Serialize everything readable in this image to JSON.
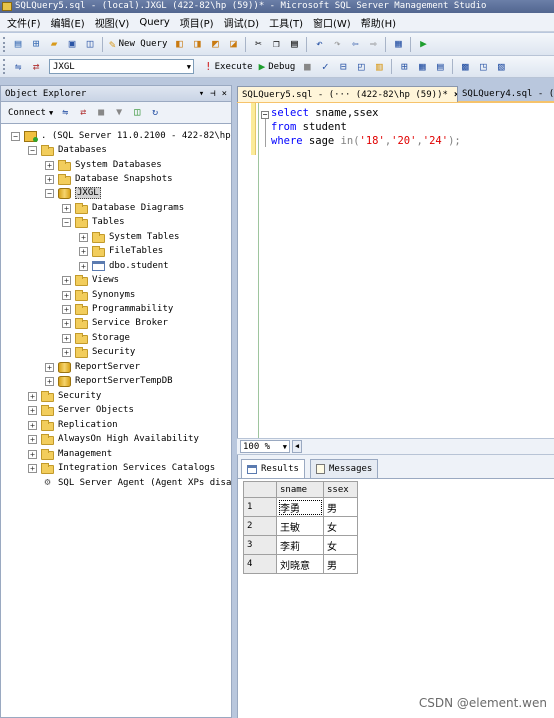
{
  "window": {
    "title": "SQLQuery5.sql - (local).JXGL (422-82\\hp (59))* - Microsoft SQL Server Management Studio"
  },
  "menu": [
    {
      "label": "文件(F)"
    },
    {
      "label": "编辑(E)"
    },
    {
      "label": "视图(V)"
    },
    {
      "label": "Query"
    },
    {
      "label": "项目(P)"
    },
    {
      "label": "调试(D)"
    },
    {
      "label": "工具(T)"
    },
    {
      "label": "窗口(W)"
    },
    {
      "label": "帮助(H)"
    }
  ],
  "toolbar1": {
    "new_query": "New Query"
  },
  "toolbar2": {
    "database": "JXGL",
    "execute": "Execute",
    "debug": "Debug"
  },
  "object_explorer": {
    "title": "Object Explorer",
    "connect": "Connect",
    "tree": [
      {
        "label": ". (SQL Server 11.0.2100 - 422-82\\hp)"
      },
      {
        "label": "Databases"
      },
      {
        "label": "System Databases"
      },
      {
        "label": "Database Snapshots"
      },
      {
        "label": "JXGL"
      },
      {
        "label": "Database Diagrams"
      },
      {
        "label": "Tables"
      },
      {
        "label": "System Tables"
      },
      {
        "label": "FileTables"
      },
      {
        "label": "dbo.student"
      },
      {
        "label": "Views"
      },
      {
        "label": "Synonyms"
      },
      {
        "label": "Programmability"
      },
      {
        "label": "Service Broker"
      },
      {
        "label": "Storage"
      },
      {
        "label": "Security"
      },
      {
        "label": "ReportServer"
      },
      {
        "label": "ReportServerTempDB"
      },
      {
        "label": "Security"
      },
      {
        "label": "Server Objects"
      },
      {
        "label": "Replication"
      },
      {
        "label": "AlwaysOn High Availability"
      },
      {
        "label": "Management"
      },
      {
        "label": "Integration Services Catalogs"
      },
      {
        "label": "SQL Server Agent (Agent XPs disabled)"
      }
    ]
  },
  "tabs": {
    "active": "SQLQuery5.sql - (··· (422-82\\hp (59))*",
    "inactive": "SQLQuery4.sql - (",
    "close": "×"
  },
  "editor": {
    "line1": {
      "kw": "select",
      "rest": " sname,ssex"
    },
    "line2": {
      "kw": "from",
      "rest": " student"
    },
    "line3": {
      "kw": "where",
      "col": " sage ",
      "op": "in",
      "p1": "(",
      "s1": "'18'",
      "c1": ",",
      "s2": "'20'",
      "c2": ",",
      "s3": "'24'",
      "p2": ");"
    }
  },
  "zoom": "100 %",
  "results": {
    "tab_results": "Results",
    "tab_messages": "Messages",
    "columns": [
      "sname",
      "ssex"
    ],
    "rows": [
      {
        "n": "1",
        "sname": "李勇",
        "ssex": "男"
      },
      {
        "n": "2",
        "sname": "王敏",
        "ssex": "女"
      },
      {
        "n": "3",
        "sname": "李莉",
        "ssex": "女"
      },
      {
        "n": "4",
        "sname": "刘晓意",
        "ssex": "男"
      }
    ]
  },
  "watermark": "CSDN @element.wen"
}
